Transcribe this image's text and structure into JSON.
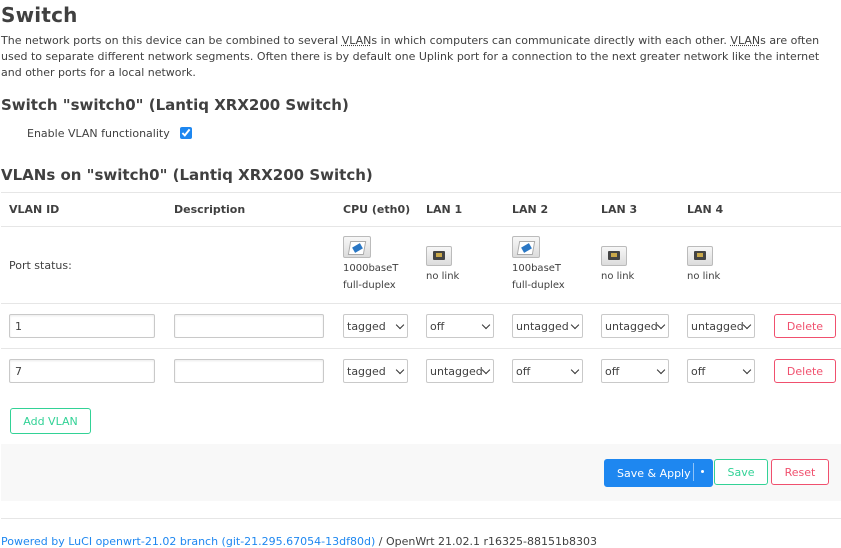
{
  "page": {
    "title": "Switch",
    "description_parts": [
      "The network ports on this device can be combined to several ",
      "VLAN",
      "s in which computers can communicate directly with each other. ",
      "VLAN",
      "s are often used to separate different network segments. Often there is by default one Uplink port for a connection to the next greater network like the internet and other ports for a local network."
    ]
  },
  "switch_section": {
    "title": "Switch \"switch0\" (Lantiq XRX200 Switch)",
    "enable_vlan_label": "Enable VLAN functionality",
    "enable_vlan_checked": true
  },
  "vlans_section": {
    "title": "VLANs on \"switch0\" (Lantiq XRX200 Switch)",
    "headers": [
      "VLAN ID",
      "Description",
      "CPU (eth0)",
      "LAN 1",
      "LAN 2",
      "LAN 3",
      "LAN 4"
    ],
    "port_status_label": "Port status:",
    "ports": [
      {
        "icon": "ethernet-link-icon",
        "line1": "1000baseT",
        "line2": "full-duplex"
      },
      {
        "icon": "ethernet-nolink-icon",
        "line1": "no link",
        "line2": ""
      },
      {
        "icon": "ethernet-link-icon",
        "line1": "100baseT",
        "line2": "full-duplex"
      },
      {
        "icon": "ethernet-nolink-icon",
        "line1": "no link",
        "line2": ""
      },
      {
        "icon": "ethernet-nolink-icon",
        "line1": "no link",
        "line2": ""
      }
    ],
    "rows": [
      {
        "vlan_id": "1",
        "description": "",
        "ports": [
          "tagged",
          "off",
          "untagged",
          "untagged",
          "untagged"
        ],
        "delete_label": "Delete"
      },
      {
        "vlan_id": "7",
        "description": "",
        "ports": [
          "tagged",
          "untagged",
          "off",
          "off",
          "off"
        ],
        "delete_label": "Delete"
      }
    ],
    "add_vlan_label": "Add VLAN"
  },
  "actions": {
    "save_apply_label": "Save & Apply",
    "save_label": "Save",
    "reset_label": "Reset"
  },
  "footer": {
    "link_text": "Powered by LuCI openwrt-21.02 branch (git-21.295.67054-13df80d)",
    "suffix": " / OpenWrt 21.02.1 r16325-88151b8303"
  },
  "colors": {
    "primary": "#1e87f0",
    "success": "#32d296",
    "danger": "#f0506e"
  }
}
